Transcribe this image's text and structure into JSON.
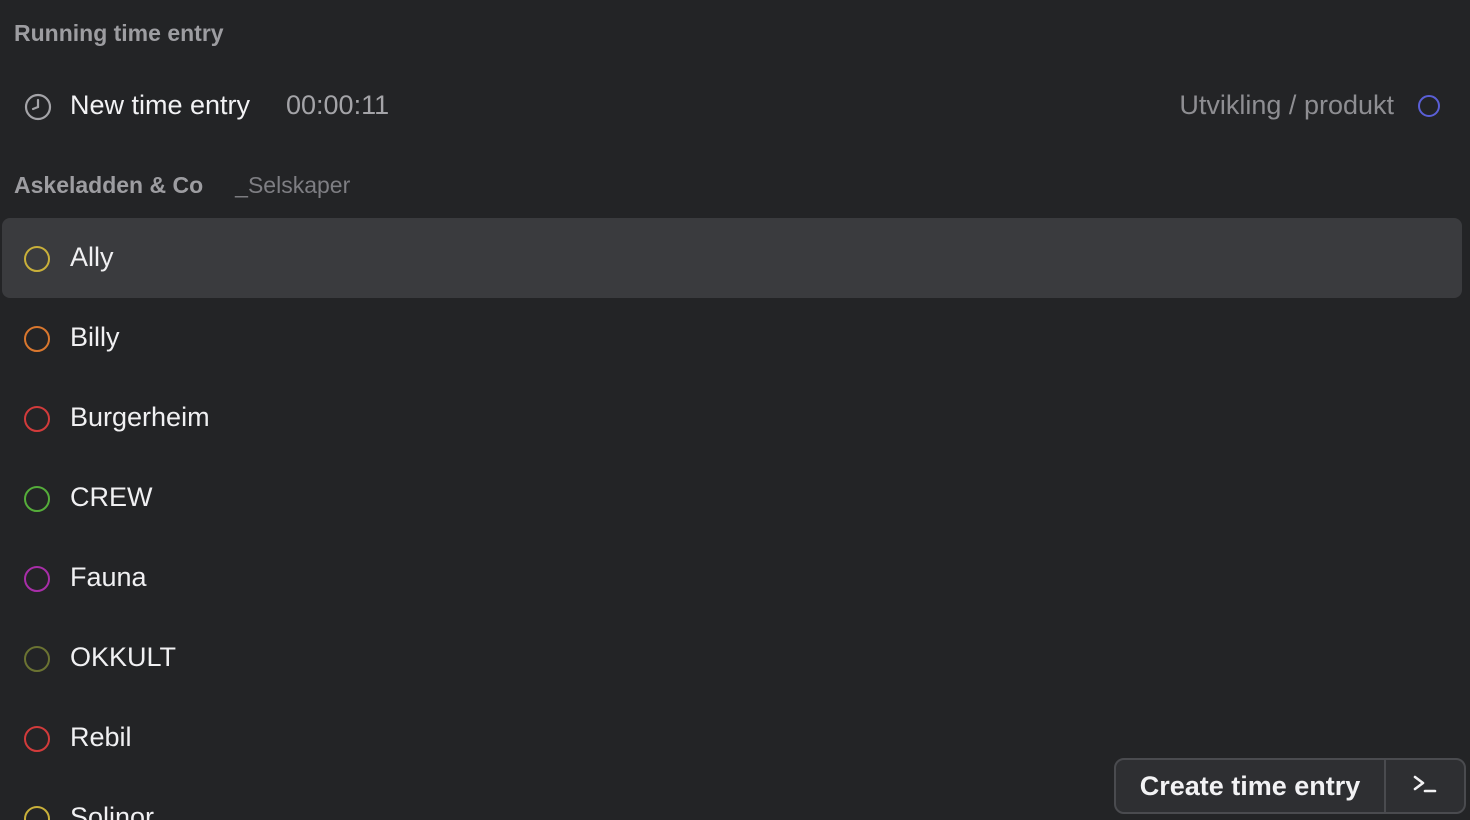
{
  "running_section": {
    "title": "Running time entry",
    "entry": {
      "icon": "clock-icon",
      "title": "New time entry",
      "elapsed": "00:00:11",
      "project": "Utvikling / produkt",
      "project_color": "#5a5fd6"
    }
  },
  "workspace_section": {
    "title": "Askeladden & Co",
    "subtitle": "_Selskaper"
  },
  "projects": [
    {
      "label": "Ally",
      "color": "#c9b03a",
      "selected": true
    },
    {
      "label": "Billy",
      "color": "#d9772e",
      "selected": false
    },
    {
      "label": "Burgerheim",
      "color": "#d23b3b",
      "selected": false
    },
    {
      "label": "CREW",
      "color": "#55ad3a",
      "selected": false
    },
    {
      "label": "Fauna",
      "color": "#a82ea8",
      "selected": false
    },
    {
      "label": "OKKULT",
      "color": "#6b7332",
      "selected": false
    },
    {
      "label": "Rebil",
      "color": "#d23b3b",
      "selected": false
    },
    {
      "label": "Solinor",
      "color": "#c9b03a",
      "selected": false
    }
  ],
  "actions": {
    "create_label": "Create time entry",
    "command_icon": "terminal-prompt-icon"
  }
}
